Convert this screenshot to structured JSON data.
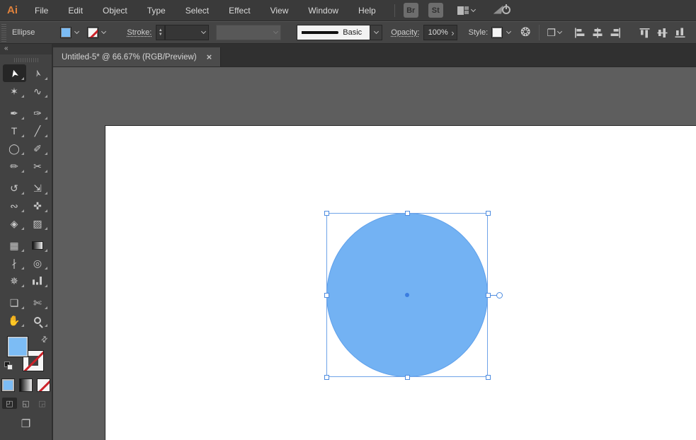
{
  "app": {
    "logo_text": "Ai",
    "logo_color": "#E0823C"
  },
  "menubar": {
    "menus": [
      {
        "label": "File"
      },
      {
        "label": "Edit"
      },
      {
        "label": "Object"
      },
      {
        "label": "Type"
      },
      {
        "label": "Select"
      },
      {
        "label": "Effect"
      },
      {
        "label": "View"
      },
      {
        "label": "Window"
      },
      {
        "label": "Help"
      }
    ],
    "bridge_button": "Br",
    "stock_button": "St",
    "icons": [
      "workspace-switcher-icon",
      "gpu-performance-icon"
    ]
  },
  "controlbar": {
    "tool_name": "Ellipse",
    "fill_color": "#7CBCF5",
    "stroke_swatch": "none",
    "stroke_label": "Stroke:",
    "stroke_width_value": "",
    "variable_width_profile_value": "",
    "brush_definition": "Basic",
    "opacity_label": "Opacity:",
    "opacity_value": "100%",
    "opacity_arrow": "›",
    "style_label": "Style:",
    "recolor_icon_glyph": "❂",
    "isolate_icon_glyph": "❐",
    "align_icons": [
      "horizontal-align-left",
      "horizontal-align-center",
      "horizontal-align-right",
      "vertical-align-top",
      "vertical-align-center",
      "vertical-align-bottom"
    ]
  },
  "tabbar": {
    "documents": [
      {
        "title": "Untitled-5* @ 66.67% (RGB/Preview)",
        "close_glyph": "×",
        "cls": "active"
      }
    ]
  },
  "toolbar": {
    "collapse_label": "«",
    "swap_glyph": "⇄",
    "tools": [
      {
        "name": "selection-tool",
        "glyph": "➤",
        "cls": "active rotc"
      },
      {
        "name": "direct-selection-tool",
        "glyph": "➢",
        "cls": "rotc"
      },
      {
        "name": "magic-wand-tool",
        "glyph": "✶"
      },
      {
        "name": "lasso-tool",
        "glyph": "∿"
      },
      {
        "name": "pen-tool",
        "glyph": "✒",
        "cls": "gap"
      },
      {
        "name": "curvature-tool",
        "glyph": "✑",
        "cls": "gap"
      },
      {
        "name": "type-tool",
        "glyph": "T"
      },
      {
        "name": "line-segment-tool",
        "glyph": "╱"
      },
      {
        "name": "ellipse-tool",
        "glyph": "◯"
      },
      {
        "name": "paintbrush-tool",
        "glyph": "✐"
      },
      {
        "name": "pencil-tool",
        "glyph": "✏"
      },
      {
        "name": "scissors-tool",
        "glyph": "✂"
      },
      {
        "name": "rotate-tool",
        "glyph": "↺",
        "cls": "gap"
      },
      {
        "name": "scale-tool",
        "glyph": "⇲",
        "cls": "gap"
      },
      {
        "name": "width-tool",
        "glyph": "∾"
      },
      {
        "name": "puppet-warp-tool",
        "glyph": "✜"
      },
      {
        "name": "shape-builder-tool",
        "glyph": "◈"
      },
      {
        "name": "perspective-grid-tool",
        "glyph": "▨"
      },
      {
        "name": "mesh-tool",
        "glyph": "▦",
        "cls": "gap"
      },
      {
        "name": "gradient-tool",
        "glyph": "",
        "cls": "gap icon-gradient"
      },
      {
        "name": "eyedropper-tool",
        "glyph": "∤"
      },
      {
        "name": "blend-tool",
        "glyph": "◎"
      },
      {
        "name": "symbol-sprayer-tool",
        "glyph": "✵"
      },
      {
        "name": "column-graph-tool",
        "glyph": "",
        "cls": "icon-bars"
      },
      {
        "name": "artboard-tool",
        "glyph": "❏",
        "cls": "gap"
      },
      {
        "name": "slice-tool",
        "glyph": "✄",
        "cls": "gap"
      },
      {
        "name": "hand-tool",
        "glyph": "✋"
      },
      {
        "name": "zoom-tool",
        "glyph": "",
        "cls": "icon-magnifier"
      }
    ],
    "fill_proxy_color": "#7CBCF5",
    "stroke_proxy": "none",
    "color_buttons": [
      {
        "name": "color-button",
        "cls": "color"
      },
      {
        "name": "gradient-button",
        "cls": "gradient"
      },
      {
        "name": "none-button",
        "cls": "none"
      }
    ],
    "drawing_modes": [
      {
        "name": "draw-normal-mode",
        "glyph": "◰",
        "cls": "active"
      },
      {
        "name": "draw-behind-mode",
        "glyph": "◱",
        "cls": ""
      },
      {
        "name": "draw-inside-mode",
        "glyph": "◲",
        "cls": "disabled"
      }
    ],
    "screen_mode_glyph": "❐"
  },
  "canvas": {
    "shape": {
      "type": "ellipse",
      "fill": "#73B2F3"
    },
    "selection_color": "#4E8CE0",
    "artboard_color": "#FFFFFF"
  }
}
